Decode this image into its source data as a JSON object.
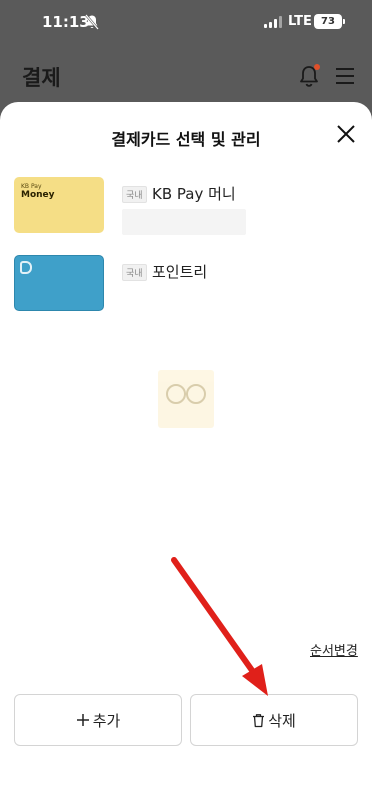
{
  "status": {
    "time": "11:13",
    "network": "LTE",
    "battery": "73"
  },
  "header": {
    "title": "결제"
  },
  "sheet": {
    "title": "결제카드 선택 및 관리",
    "cards": [
      {
        "image_small": "KB Pay",
        "image_big": "Money",
        "badge": "국내",
        "name": "KB Pay 머니"
      },
      {
        "badge": "국내",
        "name": "포인트리"
      }
    ],
    "reorder_label": "순서변경",
    "add_label": "추가",
    "delete_label": "삭제"
  },
  "colors": {
    "arrow": "#e0201a",
    "kb_card": "#f5de86",
    "point_card": "#3fa0c9"
  }
}
